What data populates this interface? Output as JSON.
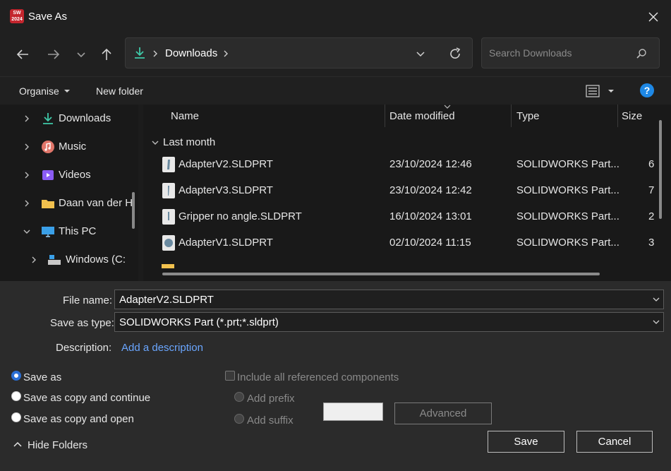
{
  "window": {
    "title": "Save As",
    "app_icon_text": "SW 2024"
  },
  "address": {
    "path": "Downloads"
  },
  "search": {
    "placeholder": "Search Downloads"
  },
  "commands": {
    "organise": "Organise",
    "new_folder": "New folder"
  },
  "sidebar": {
    "items": [
      {
        "label": "Downloads",
        "icon": "download-icon"
      },
      {
        "label": "Music",
        "icon": "music-icon"
      },
      {
        "label": "Videos",
        "icon": "video-icon"
      },
      {
        "label": "Daan van der H",
        "icon": "folder-icon"
      },
      {
        "label": "This PC",
        "icon": "monitor-icon"
      },
      {
        "label": "Windows (C:",
        "icon": "drive-icon"
      }
    ]
  },
  "columns": {
    "name": "Name",
    "date": "Date modified",
    "type": "Type",
    "size": "Size"
  },
  "group": "Last month",
  "files": [
    {
      "name": "AdapterV2.SLDPRT",
      "date": "23/10/2024 12:46",
      "type": "SOLIDWORKS Part...",
      "size": "6"
    },
    {
      "name": "AdapterV3.SLDPRT",
      "date": "23/10/2024 12:42",
      "type": "SOLIDWORKS Part...",
      "size": "7"
    },
    {
      "name": "Gripper no angle.SLDPRT",
      "date": "16/10/2024 13:01",
      "type": "SOLIDWORKS Part...",
      "size": "2"
    },
    {
      "name": "AdapterV1.SLDPRT",
      "date": "02/10/2024 11:15",
      "type": "SOLIDWORKS Part...",
      "size": "3"
    }
  ],
  "form": {
    "file_name_label": "File name:",
    "file_name_value": "AdapterV2.SLDPRT",
    "save_type_label": "Save as type:",
    "save_type_value": "SOLIDWORKS Part (*.prt;*.sldprt)",
    "description_label": "Description:",
    "description_link": "Add a description"
  },
  "options": {
    "save_as": "Save as",
    "save_copy_continue": "Save as copy and continue",
    "save_copy_open": "Save as copy and open",
    "include_refs": "Include all referenced components",
    "add_prefix": "Add prefix",
    "add_suffix": "Add suffix",
    "advanced": "Advanced"
  },
  "footer": {
    "hide_folders": "Hide Folders",
    "save": "Save",
    "cancel": "Cancel"
  },
  "colors": {
    "accent": "#2a6fd6",
    "link": "#6aa6ff",
    "help": "#1e88e5"
  }
}
